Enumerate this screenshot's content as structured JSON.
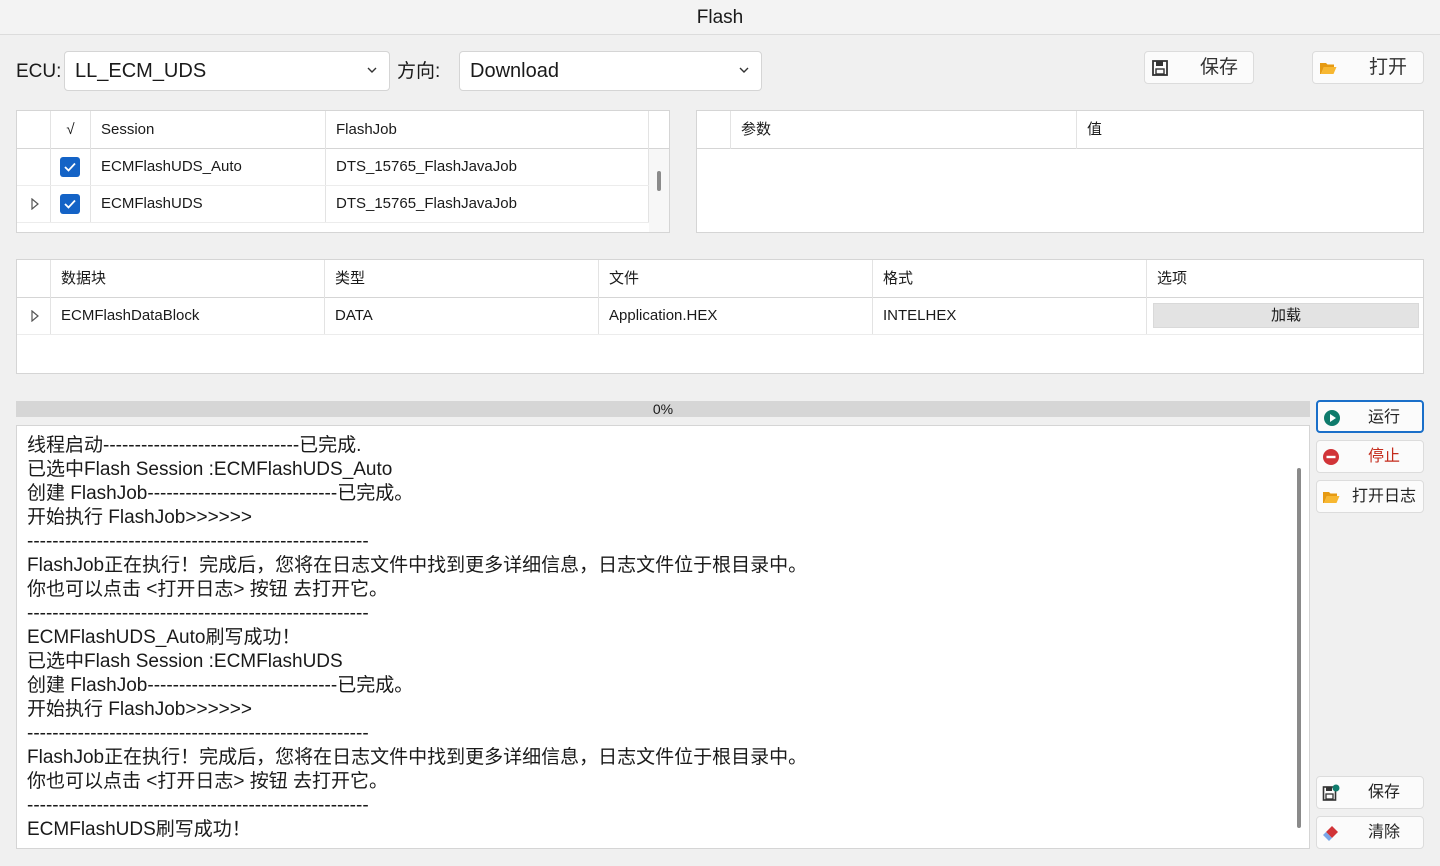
{
  "window": {
    "title": "Flash"
  },
  "toolbar": {
    "ecu_label": "ECU:",
    "ecu_value": "LL_ECM_UDS",
    "direction_label": "方向:",
    "direction_value": "Download",
    "save_label": "保存",
    "open_label": "打开"
  },
  "session_table": {
    "headers": [
      "√",
      "Session",
      "FlashJob"
    ],
    "rows": [
      {
        "checked": true,
        "session": "ECMFlashUDS_Auto",
        "flashjob": "DTS_15765_FlashJavaJob"
      },
      {
        "checked": true,
        "session": "ECMFlashUDS",
        "flashjob": "DTS_15765_FlashJavaJob"
      }
    ]
  },
  "param_table": {
    "headers": [
      "参数",
      "值"
    ]
  },
  "datablock_table": {
    "headers": [
      "数据块",
      "类型",
      "文件",
      "格式",
      "选项"
    ],
    "rows": [
      {
        "block": "ECMFlashDataBlock",
        "type": "DATA",
        "file": "Application.HEX",
        "format": "INTELHEX",
        "option": "加载"
      }
    ]
  },
  "progress": {
    "value": 0,
    "label": "0%"
  },
  "log": {
    "lines": [
      "线程启动-------------------------------已完成.",
      "已选中Flash Session :ECMFlashUDS_Auto",
      "创建 FlashJob------------------------------已完成。",
      "开始执行 FlashJob>>>>>>",
      "------------------------------------------------------",
      "FlashJob正在执行！完成后，您将在日志文件中找到更多详细信息，日志文件位于根目录中。",
      "你也可以点击 <打开日志> 按钮 去打开它。",
      "------------------------------------------------------",
      "ECMFlashUDS_Auto刷写成功！",
      "已选中Flash Session :ECMFlashUDS",
      "创建 FlashJob------------------------------已完成。",
      "开始执行 FlashJob>>>>>>",
      "------------------------------------------------------",
      "FlashJob正在执行！完成后，您将在日志文件中找到更多详细信息，日志文件位于根目录中。",
      "你也可以点击 <打开日志> 按钮 去打开它。",
      "------------------------------------------------------",
      "ECMFlashUDS刷写成功！"
    ]
  },
  "side_buttons": {
    "run_label": "运行",
    "stop_label": "停止",
    "open_log_label": "打开日志",
    "save_log_label": "保存",
    "clear_label": "清除"
  },
  "colors": {
    "accent": "#1463c6",
    "run": "#0f7b6c",
    "stop": "#d13438",
    "folder": "#f2a623"
  },
  "icons": {
    "save": "floppy-icon",
    "open": "folder-open-icon",
    "run": "play-circle-icon",
    "stop": "stop-circle-icon",
    "open_log": "folder-open-icon",
    "save_log": "save-log-icon",
    "clear": "eraser-icon"
  }
}
